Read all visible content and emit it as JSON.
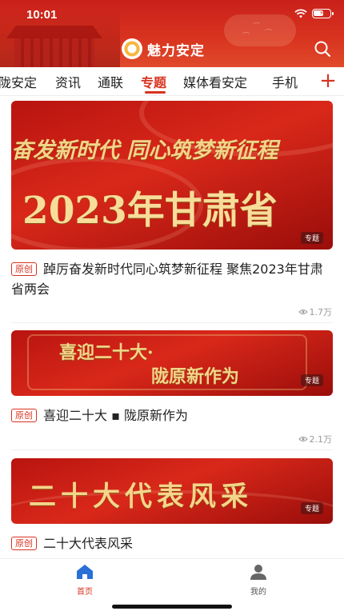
{
  "status_bar": {
    "time": "10:01"
  },
  "header": {
    "app_title": "魅力安定",
    "icons": [
      "search-icon"
    ]
  },
  "tabs": [
    {
      "label": "陇安定",
      "active": false
    },
    {
      "label": "资讯",
      "active": false
    },
    {
      "label": "通联",
      "active": false
    },
    {
      "label": "专题",
      "active": true
    },
    {
      "label": "媒体看安定",
      "active": false
    },
    {
      "label": "手机",
      "active": false
    }
  ],
  "add_channel_icon": "plus-icon",
  "accent_color": "#d8321f",
  "feed": [
    {
      "banner_lines": [
        "奋发新时代  同心筑梦新征程",
        "2023年甘肃省"
      ],
      "tag": "专题",
      "badge": "原创",
      "title": "踔厉奋发新时代同心筑梦新征程 聚焦2023年甘肃省两会",
      "views": "1.7万"
    },
    {
      "banner_lines": [
        "喜迎二十大·",
        "陇原新作为"
      ],
      "tag": "专题",
      "badge": "原创",
      "title": "喜迎二十大 ▪ 陇原新作为",
      "views": "2.1万"
    },
    {
      "banner_lines": [
        "二十大代表风采"
      ],
      "tag": "专题",
      "badge": "原创",
      "title": "二十大代表风采"
    }
  ],
  "bottom_nav": [
    {
      "label": "首页",
      "icon": "home-icon",
      "active": true
    },
    {
      "label": "我的",
      "icon": "user-icon",
      "active": false
    }
  ]
}
